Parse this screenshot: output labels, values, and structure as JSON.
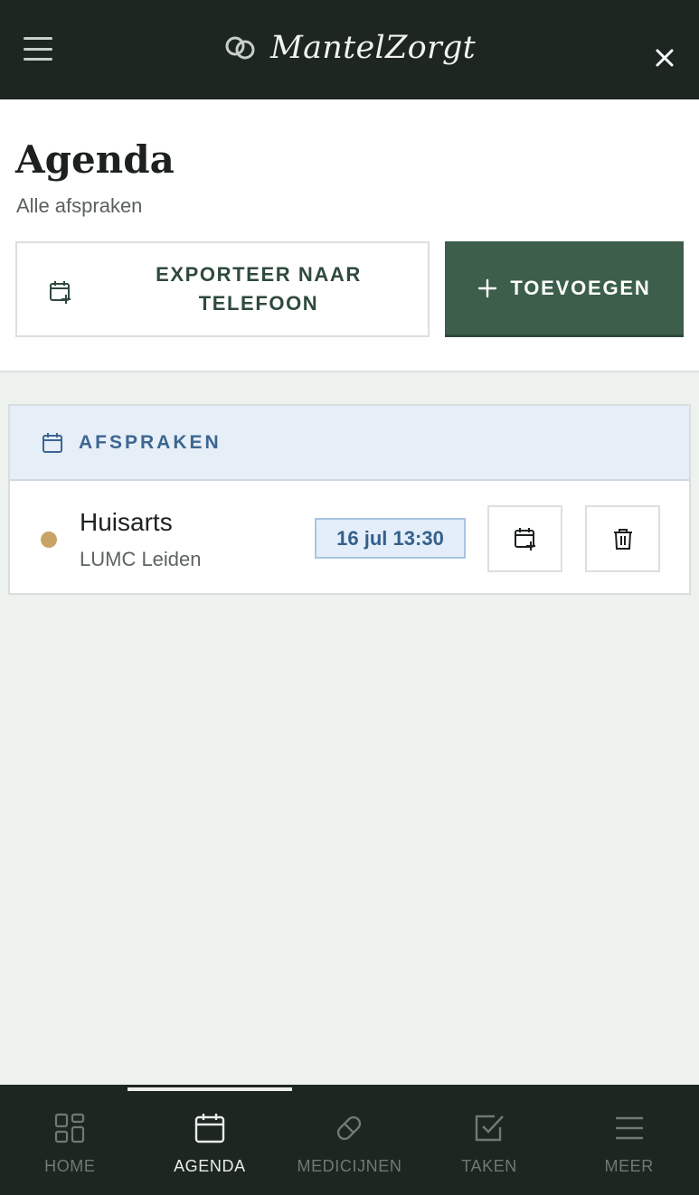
{
  "app": {
    "title": "MantelZorgt",
    "icons": {
      "menu": "hamburger-icon",
      "close": "close-icon",
      "logo": "interlocking-circles-logo"
    }
  },
  "page": {
    "title": "Agenda",
    "subtitle": "Alle afspraken"
  },
  "actions": {
    "export_label": "EXPORTEER NAAR TELEFOON",
    "export_icon": "calendar-plus-icon",
    "add_label": "TOEVOEGEN",
    "add_icon": "plus-icon"
  },
  "appointments_section": {
    "heading": "AFSPRAKEN",
    "heading_icon": "calendar-icon",
    "items": [
      {
        "title": "Huisarts",
        "location": "LUMC Leiden",
        "datetime": "16 jul 13:30",
        "status_color": "#c9a366"
      }
    ]
  },
  "nav": {
    "items": [
      {
        "label": "HOME",
        "icon": "grid-icon",
        "active": false
      },
      {
        "label": "AGENDA",
        "icon": "calendar-icon",
        "active": true
      },
      {
        "label": "MEDICIJNEN",
        "icon": "pill-icon",
        "active": false
      },
      {
        "label": "TAKEN",
        "icon": "checkbox-icon",
        "active": false
      },
      {
        "label": "MEER",
        "icon": "menu-icon",
        "active": false
      }
    ]
  },
  "colors": {
    "topbar": "#1d2621",
    "primary_button": "#3c5e4b",
    "accent_blue": "#3d6690",
    "background": "#edf2ee"
  }
}
